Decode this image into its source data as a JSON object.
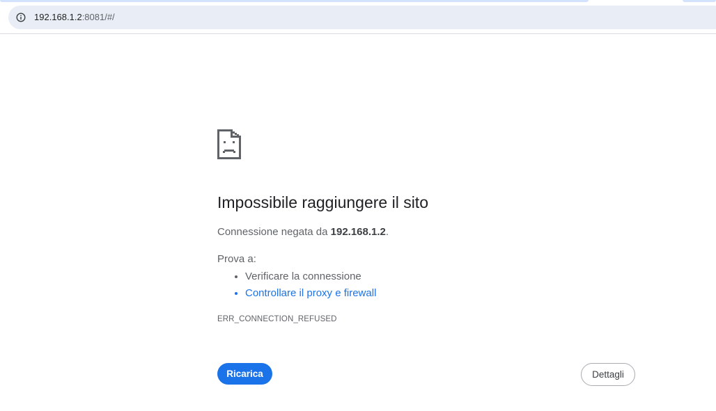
{
  "browser": {
    "url_host": "192.168.1.2",
    "url_rest": ":8081/#/",
    "info_icon": "info-icon"
  },
  "error_page": {
    "icon": "sad-page-icon",
    "title": "Impossibile raggiungere il sito",
    "description_prefix": "Connessione negata da ",
    "description_host": "192.168.1.2",
    "description_suffix": ".",
    "try_label": "Prova a:",
    "suggestions": [
      "Verificare la connessione",
      "Controllare il proxy e firewall"
    ],
    "error_code": "ERR_CONNECTION_REFUSED",
    "reload_label": "Ricarica",
    "details_label": "Dettagli"
  },
  "colors": {
    "accent": "#1a73e8",
    "omnibox_bg": "#e9eef6",
    "secondary_text": "#5f6368"
  }
}
